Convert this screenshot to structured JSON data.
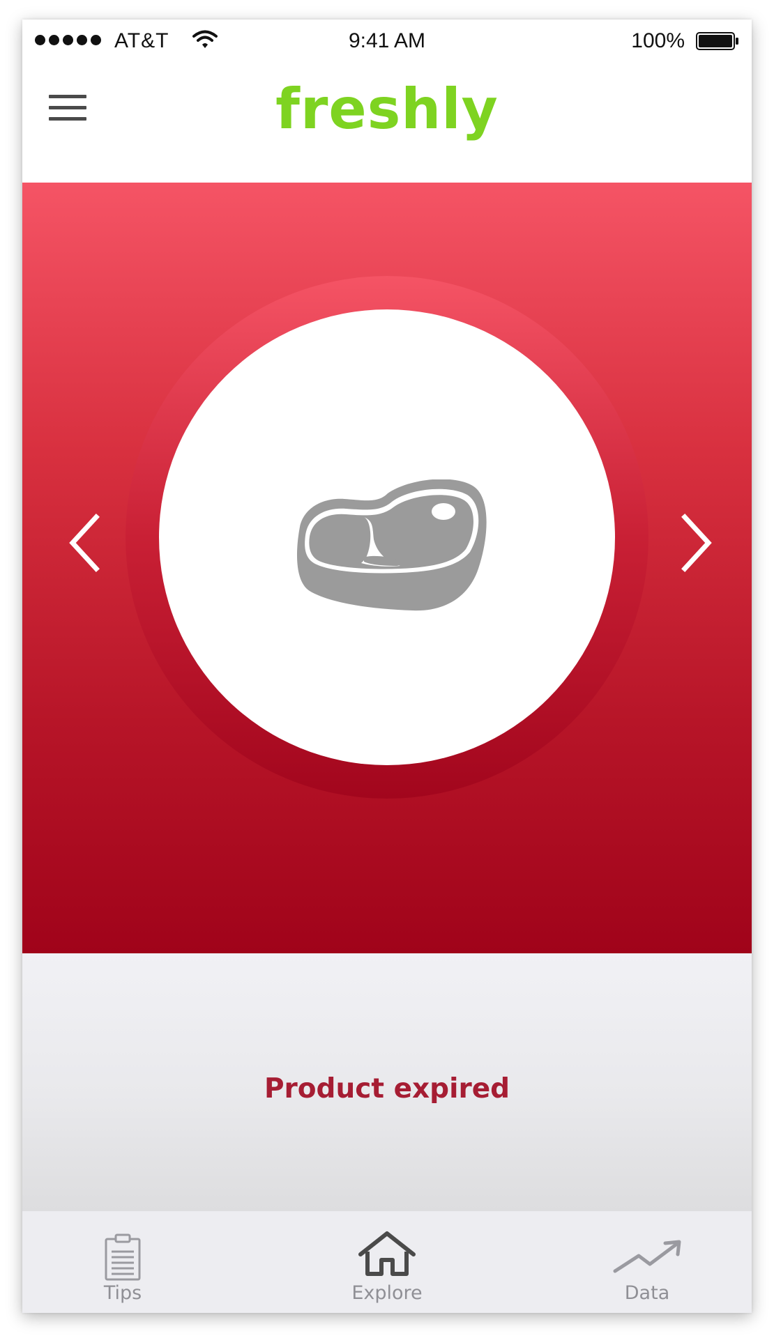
{
  "status_bar": {
    "carrier": "AT&T",
    "time": "9:41 AM",
    "battery": "100%",
    "icons": [
      "signal-dots-icon",
      "wifi-icon",
      "battery-icon"
    ]
  },
  "header": {
    "brand": "freshly",
    "menu_icon": "hamburger-menu-icon"
  },
  "hero": {
    "product_icon": "steak-icon",
    "prev_icon": "chevron-left-icon",
    "next_icon": "chevron-right-icon"
  },
  "status": {
    "text": "Product expired"
  },
  "tabs": [
    {
      "label": "Tips",
      "icon": "clipboard-icon"
    },
    {
      "label": "Explore",
      "icon": "home-icon"
    },
    {
      "label": "Data",
      "icon": "trend-up-icon"
    }
  ],
  "colors": {
    "brand_green": "#7ed321",
    "hero_top": "#f55465",
    "hero_bottom": "#a0031a",
    "status_text": "#a61d33",
    "tab_label": "#8f8f95"
  }
}
